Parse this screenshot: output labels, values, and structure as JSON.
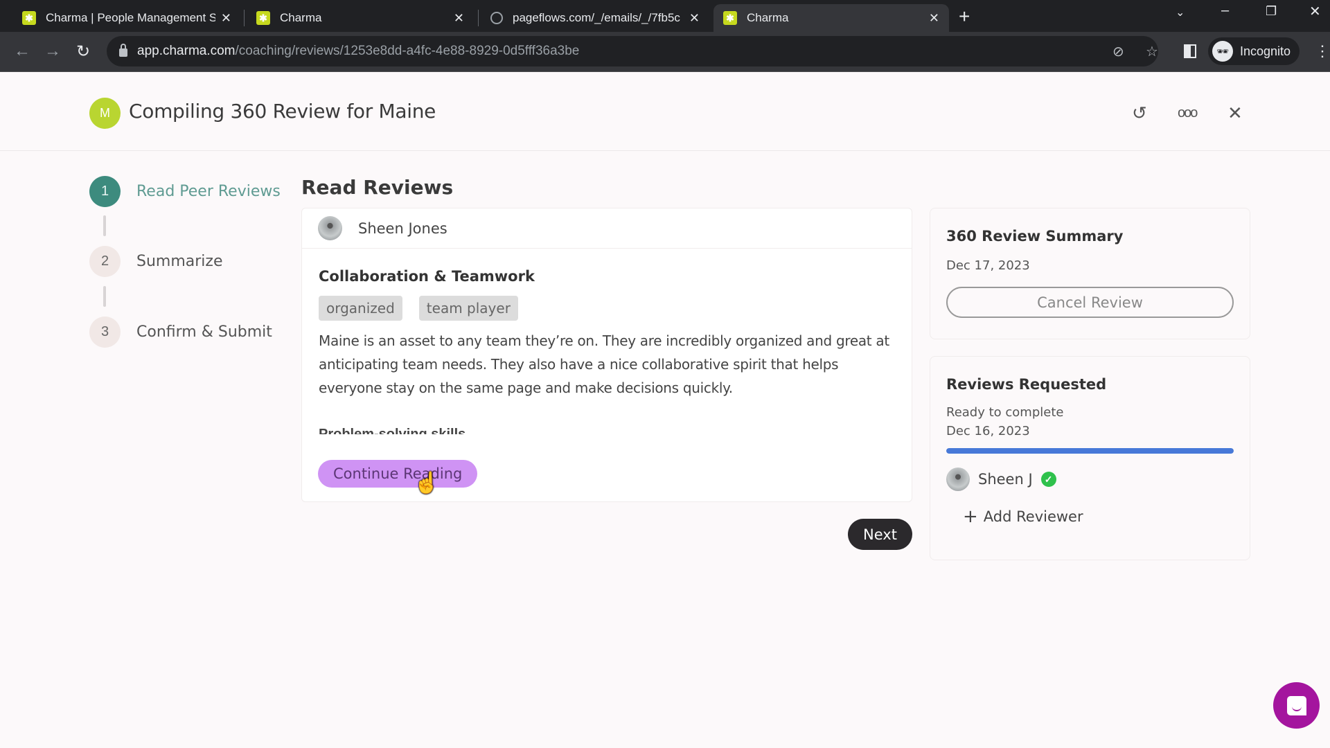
{
  "browser": {
    "tabs": [
      {
        "title": "Charma | People Management S",
        "favicon": "charma-logo-icon",
        "active": false
      },
      {
        "title": "Charma",
        "favicon": "charma-logo-icon",
        "active": false
      },
      {
        "title": "pageflows.com/_/emails/_/7fb5c",
        "favicon": "globe-icon",
        "active": false
      },
      {
        "title": "Charma",
        "favicon": "charma-logo-icon",
        "active": true
      }
    ],
    "close_glyph": "✕",
    "new_tab_glyph": "+",
    "url_host": "app.charma.com",
    "url_path": "/coaching/reviews/1253e8dd-a4fc-4e88-8929-0d5fff36a3be",
    "profile_label": "Incognito"
  },
  "header": {
    "avatar_initial": "M",
    "title": "Compiling 360 Review for Maine"
  },
  "stepper": {
    "steps": [
      {
        "number": "1",
        "label": "Read Peer Reviews",
        "active": true
      },
      {
        "number": "2",
        "label": "Summarize",
        "active": false
      },
      {
        "number": "3",
        "label": "Confirm & Submit",
        "active": false
      }
    ]
  },
  "main": {
    "section_title": "Read Reviews",
    "review": {
      "reviewer_name": "Sheen Jones",
      "category": "Collaboration & Teamwork",
      "tags": [
        "organized",
        "team player"
      ],
      "text": "Maine is an asset to any team they’re on. They are incredibly organized and great at anticipating team needs. They also have a nice collaborative spirit that helps everyone stay on the same page and make decisions quickly.",
      "truncated_next_heading": "Problem-solving skills",
      "continue_label": "Continue Reading"
    },
    "next_label": "Next"
  },
  "sidebar": {
    "summary": {
      "title": "360 Review Summary",
      "date": "Dec 17, 2023",
      "cancel_label": "Cancel Review"
    },
    "requested": {
      "title": "Reviews Requested",
      "status": "Ready to complete",
      "date": "Dec 16, 2023",
      "progress_percent": 100,
      "progress_color": "#4779d8",
      "reviewers": [
        {
          "name": "Sheen J",
          "completed": true
        }
      ],
      "add_label": "Add Reviewer"
    }
  },
  "colors": {
    "brand_green": "#b9d531",
    "step_active": "#3d8b7e",
    "continue_button": "#cf93f4",
    "next_button": "#2b292c",
    "chat_launcher": "#a4159e",
    "check_green": "#2fc14c"
  }
}
